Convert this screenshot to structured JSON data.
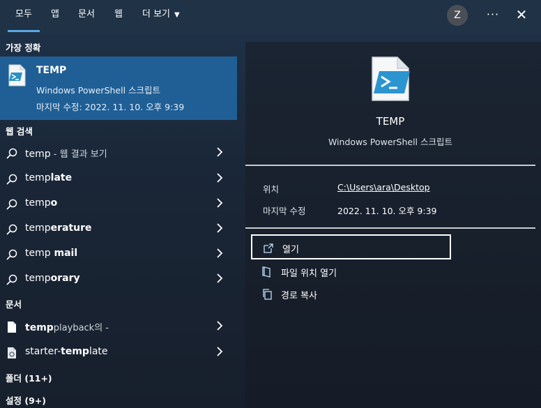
{
  "tabs": [
    {
      "label": "모두",
      "active": true
    },
    {
      "label": "앱"
    },
    {
      "label": "문서"
    },
    {
      "label": "웹"
    },
    {
      "label": "더 보기"
    }
  ],
  "header": {
    "avatar_letter": "Z",
    "more_label": "···",
    "close_label": "✕"
  },
  "sections": {
    "best_match": "가장 정확",
    "web_search": "웹 검색",
    "documents": "문서",
    "folders": "폴더 (11+)",
    "settings": "설정 (9+)"
  },
  "best_match": {
    "title": "TEMP",
    "type": "Windows PowerShell 스크립트",
    "modified": "마지막 수정: 2022. 11. 10. 오후 9:39",
    "icon": "powershell-script-icon"
  },
  "web_results": [
    {
      "prefix": "temp",
      "suffix": " - 웹 결과 보기",
      "icon": "search-icon"
    },
    {
      "prefix": "temp",
      "suffix": "late",
      "icon": "search-icon"
    },
    {
      "prefix": "temp",
      "suffix": "o",
      "icon": "search-icon"
    },
    {
      "prefix": "temp",
      "suffix": "erature",
      "icon": "search-icon"
    },
    {
      "prefix": "temp",
      "suffix": " mail",
      "icon": "search-icon"
    },
    {
      "prefix": "temp",
      "suffix": "orary",
      "icon": "search-icon"
    }
  ],
  "documents": [
    {
      "bold": "temp",
      "rest": "playback의 -",
      "icon": "document-icon"
    },
    {
      "pre": "starter-",
      "bold": "temp",
      "post": "late",
      "icon": "document-gear-icon"
    }
  ],
  "detail": {
    "title": "TEMP",
    "subtitle": "Windows PowerShell 스크립트",
    "location_label": "위치",
    "location_value": "C:\\Users\\ara\\Desktop",
    "modified_label": "마지막 수정",
    "modified_value": "2022. 11. 10. 오후 9:39",
    "actions": [
      {
        "label": "열기",
        "icon": "open-external-icon",
        "focused": true
      },
      {
        "label": "파일 위치 열기",
        "icon": "folder-open-icon"
      },
      {
        "label": "경로 복사",
        "icon": "copy-icon"
      }
    ]
  },
  "colors": {
    "accent": "#5aa7e6",
    "selected_bg": "#1f5f95"
  }
}
